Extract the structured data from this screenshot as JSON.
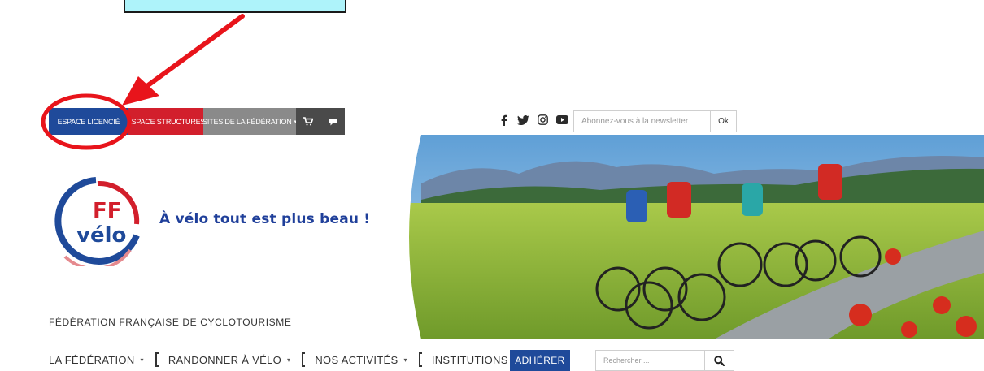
{
  "topbar": {
    "espace_licencie": "ESPACE LICENCIÉ",
    "espace_structures": "ESPACE STRUCTURES",
    "sites_federation": "SITES DE LA FÉDÉRATION",
    "caret": "▾"
  },
  "newsletter": {
    "placeholder": "Abonnez-vous à la newsletter",
    "ok_label": "Ok"
  },
  "social": {
    "icons": [
      "facebook-icon",
      "twitter-icon",
      "instagram-icon",
      "youtube-icon"
    ]
  },
  "logo": {
    "line1": "FF",
    "line2": "vélo"
  },
  "tagline": "À vélo tout est plus beau !",
  "federation_name": "FÉDÉRATION FRANÇAISE DE CYCLOTOURISME",
  "mainnav": {
    "items": [
      {
        "label": "LA FÉDÉRATION"
      },
      {
        "label": "RANDONNER À VÉLO"
      },
      {
        "label": "NOS ACTIVITÉS"
      },
      {
        "label": "INSTITUTIONS"
      }
    ],
    "caret": "▾"
  },
  "adherer_label": "ADHÉRER",
  "search": {
    "placeholder": "Rechercher ..."
  },
  "colors": {
    "brand_blue": "#1f4a9a",
    "brand_red": "#d21f2c",
    "annotation_red": "#e8141b",
    "annotation_cyan": "#aef3fa"
  }
}
